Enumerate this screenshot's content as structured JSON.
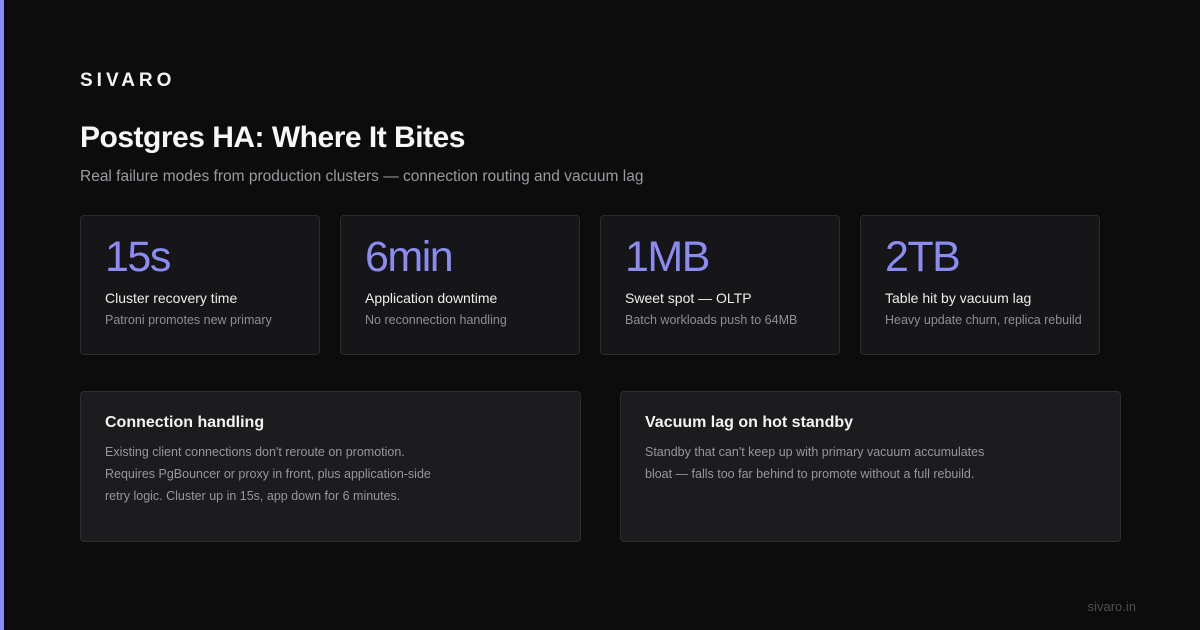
{
  "brand": "SIVARO",
  "title": "Postgres HA: Where It Bites",
  "subtitle": "Real failure modes from production clusters — connection routing and vacuum lag",
  "colors": {
    "accent": "#8b8cf2",
    "background": "#0c0c0d",
    "card": "#161618",
    "panel": "#1c1c1e"
  },
  "stats": [
    {
      "value": "15s",
      "label": "Cluster recovery time",
      "sub": "Patroni promotes new primary"
    },
    {
      "value": "6min",
      "label": "Application downtime",
      "sub": "No reconnection handling"
    },
    {
      "value": "1MB",
      "label": "Sweet spot — OLTP",
      "sub": "Batch workloads push to 64MB"
    },
    {
      "value": "2TB",
      "label": "Table hit by vacuum lag",
      "sub": "Heavy update churn, replica rebuild"
    }
  ],
  "panels": [
    {
      "title": "Connection handling",
      "body": "Existing client connections don't reroute on promotion. Requires PgBouncer or proxy in front, plus application-side retry logic. Cluster up in 15s, app down for 6 minutes."
    },
    {
      "title": "Vacuum lag on hot standby",
      "body": "Standby that can't keep up with primary vacuum accumulates bloat — falls too far behind to promote without a full rebuild."
    }
  ],
  "footer": "sivaro.in"
}
